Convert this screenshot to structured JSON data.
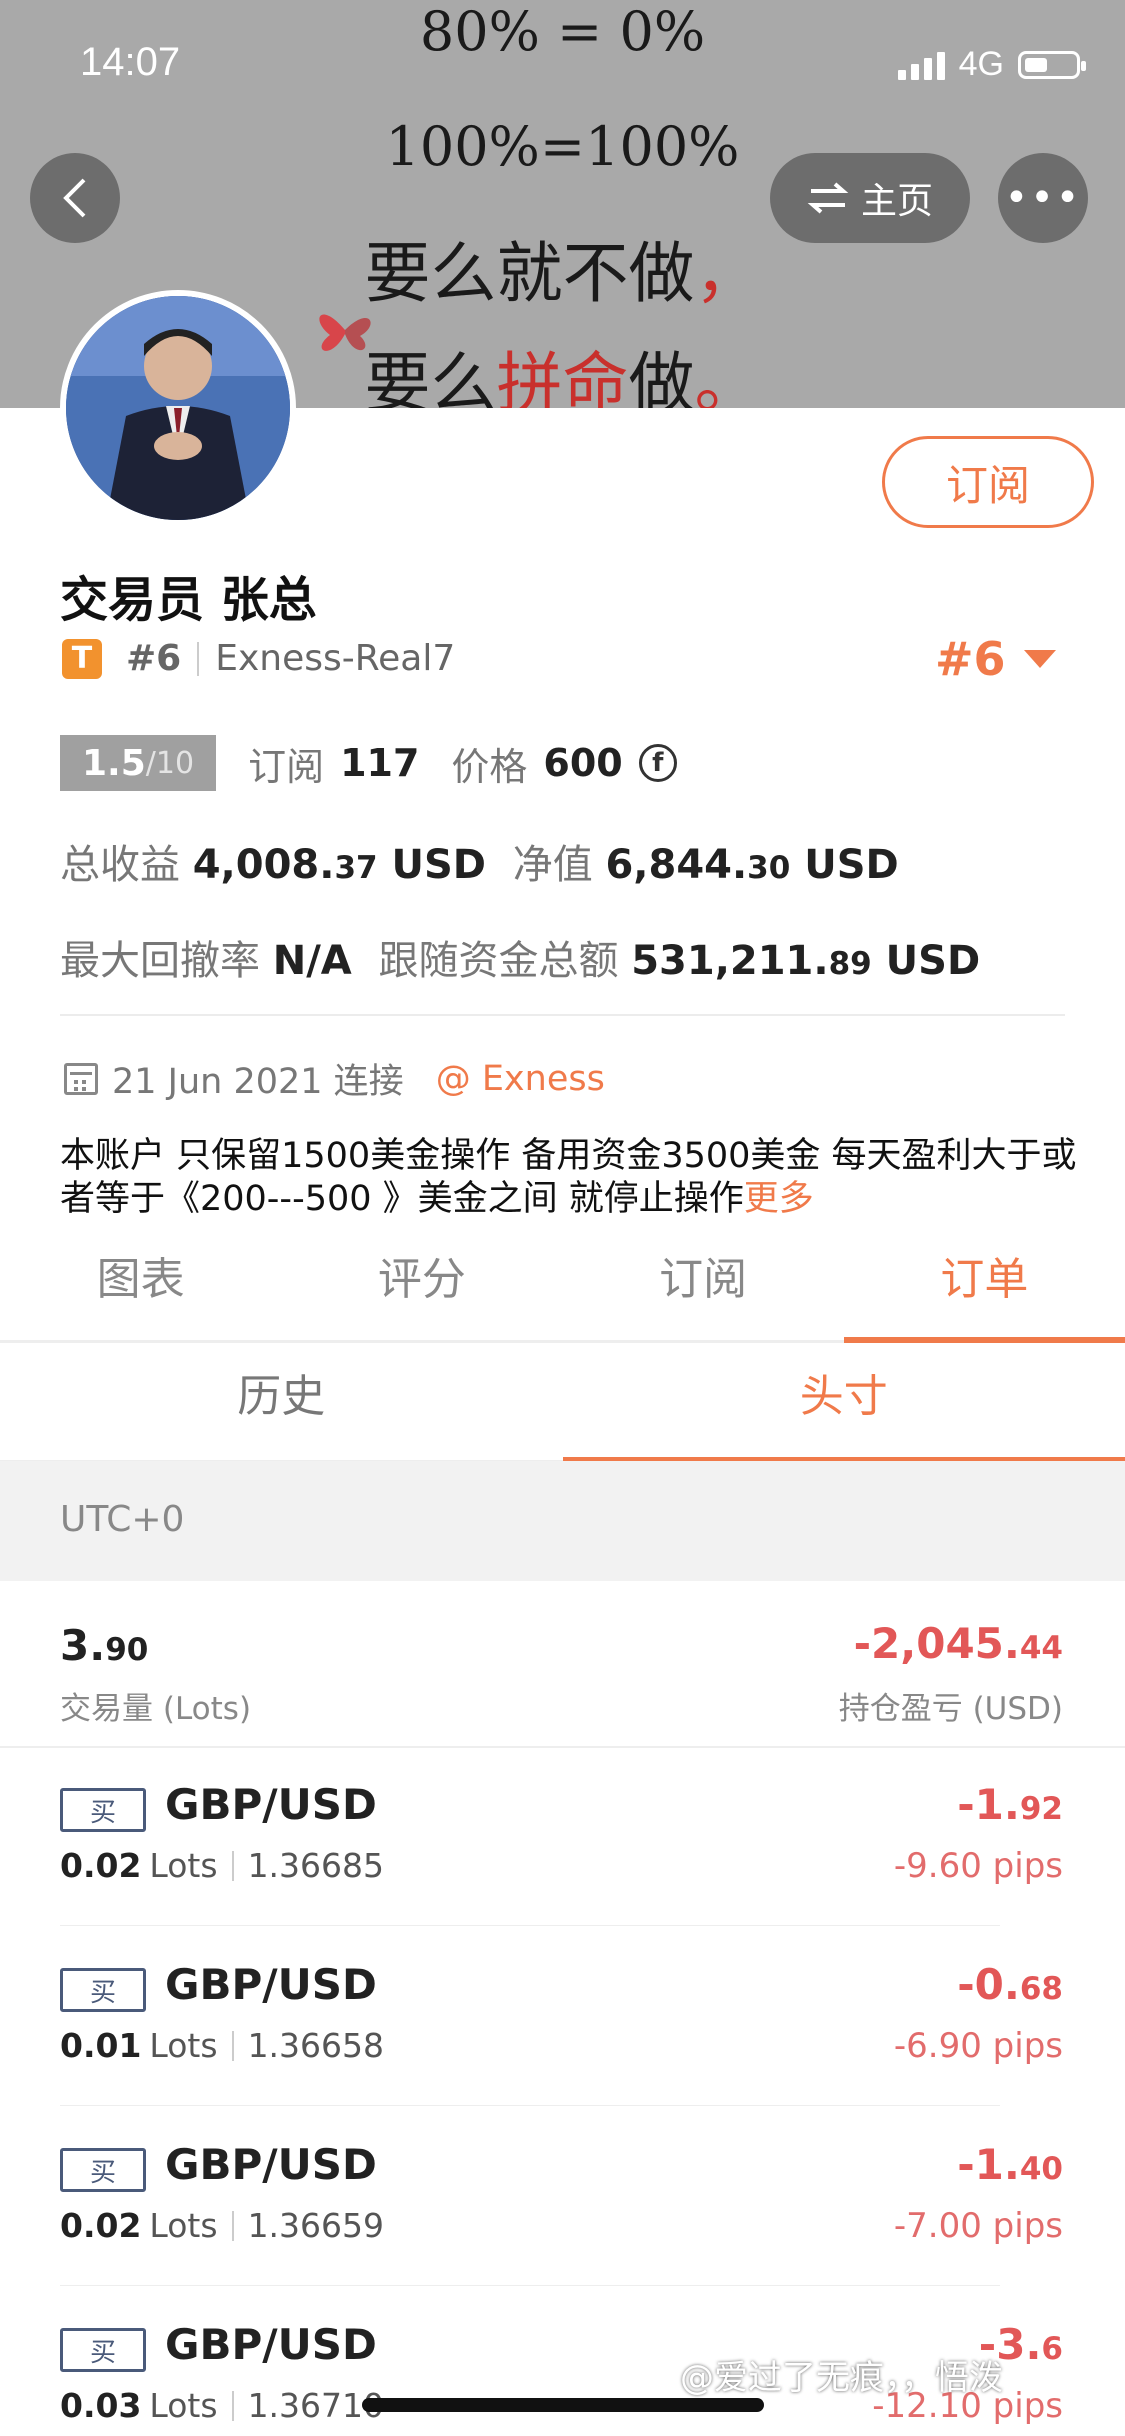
{
  "status_bar": {
    "time": "14:07",
    "network": "4G"
  },
  "banner": {
    "line1": "80% = 0%",
    "line2": "100%=100%",
    "line3_a": "要么就不做",
    "line3_b": "，",
    "line4_a": "要么",
    "line4_b": "拼命",
    "line4_c": "做",
    "line4_d": "。"
  },
  "nav": {
    "home_label": "主页",
    "more_label": "•••"
  },
  "profile": {
    "subscribe_label": "订阅",
    "name": "交易员  张总",
    "tier_badge": "T",
    "rank": "#6",
    "server": "Exness-Real7",
    "rank_right": "#6"
  },
  "stats": {
    "score_main": "1.5",
    "score_den": "/10",
    "subscriptions_label": "订阅",
    "subscriptions_value": "117",
    "price_label": "价格",
    "price_value": "600",
    "coin_symbol": "f",
    "total_profit_label": "总收益",
    "total_profit_int": "4,008.",
    "total_profit_dec": "37",
    "total_profit_unit": "USD",
    "equity_label": "净值",
    "equity_int": "6,844.",
    "equity_dec": "30",
    "equity_unit": "USD",
    "max_drawdown_label": "最大回撤率",
    "max_drawdown_value": "N/A",
    "follow_funds_label": "跟随资金总额",
    "follow_funds_int": "531,211.",
    "follow_funds_dec": "89",
    "follow_funds_unit": "USD"
  },
  "connection": {
    "date": "21 Jun 2021 连接",
    "broker": "@ Exness"
  },
  "description": {
    "text": "本账户  只保留1500美金操作  备用资金3500美金    每天盈利大于或者等于《200---500 》美金之间   就停止操作",
    "more_label": "更多"
  },
  "tabs": [
    {
      "label": "图表"
    },
    {
      "label": "评分"
    },
    {
      "label": "订阅"
    },
    {
      "label": "订单"
    }
  ],
  "subtabs": [
    {
      "label": "历史"
    },
    {
      "label": "头寸"
    }
  ],
  "timezone": "UTC+0",
  "summary": {
    "volume_int": "3.",
    "volume_dec": "90",
    "volume_label": "交易量 (Lots)",
    "pnl_int": "-2,045.",
    "pnl_dec": "44",
    "pnl_label": "持仓盈亏 (USD)"
  },
  "orders": [
    {
      "side": "买",
      "pair": "GBP/USD",
      "lots": "0.02",
      "lots_unit": "Lots",
      "price": "1.36685",
      "pnl_int": "-1.",
      "pnl_dec": "92",
      "pips": "-9.60 pips"
    },
    {
      "side": "买",
      "pair": "GBP/USD",
      "lots": "0.01",
      "lots_unit": "Lots",
      "price": "1.36658",
      "pnl_int": "-0.",
      "pnl_dec": "68",
      "pips": "-6.90 pips"
    },
    {
      "side": "买",
      "pair": "GBP/USD",
      "lots": "0.02",
      "lots_unit": "Lots",
      "price": "1.36659",
      "pnl_int": "-1.",
      "pnl_dec": "40",
      "pips": "-7.00 pips"
    },
    {
      "side": "买",
      "pair": "GBP/USD",
      "lots": "0.03",
      "lots_unit": "Lots",
      "price": "1.36710",
      "pnl_int": "-3.",
      "pnl_dec": "6",
      "pips": "-12.10 pips"
    }
  ],
  "watermark": "@爱过了无痕，，悟泼",
  "colors": {
    "accent": "#f07a4a",
    "loss": "#e25757",
    "banner_gray": "#a9a9a9"
  }
}
